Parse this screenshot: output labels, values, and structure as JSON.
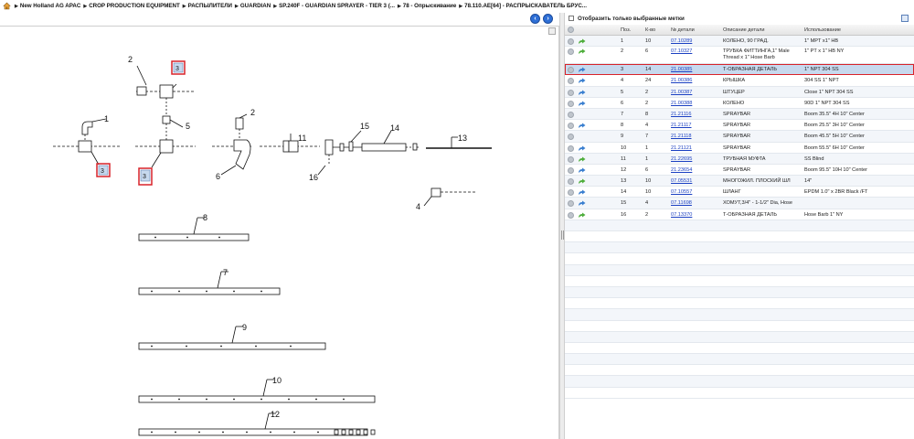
{
  "breadcrumb": [
    "New Holland AG APAC",
    "CROP PRODUCTION EQUIPMENT",
    "РАСПЫЛИТЕЛИ",
    "GUARDIAN",
    "SP.240F - GUARDIAN SPRAYER - TIER 3 (...",
    "78 - Опрыскивание",
    "78.110.AE[64] - РАСПРЫСКАВАТЕЛЬ БРУС..."
  ],
  "nav": {
    "back": "‹",
    "forward": "›"
  },
  "filter": {
    "label": "Отобразить только выбранные метки"
  },
  "table": {
    "headers": {
      "pos": "Поз.",
      "qty": "К-во",
      "num": "№ детали",
      "desc": "Описание детали",
      "use": "Использование"
    },
    "rows": [
      {
        "pos": "1",
        "qty": "10",
        "num": "07.10289",
        "desc": "КОЛЕНО, 90 ГРАД.",
        "use": "1\" MPT x1\" HB",
        "arrow": "green"
      },
      {
        "pos": "2",
        "qty": "6",
        "num": "07.10327",
        "desc": "ТРУБКА ФИТТИНГА,1\" Male Thread x 1\" Hose Barb",
        "use": "1\" PT x 1\" HB NY",
        "arrow": "green"
      },
      {
        "pos": "3",
        "qty": "14",
        "num": "21.00385",
        "desc": "Т-ОБРАЗНАЯ ДЕТАЛЬ",
        "use": "1\" NPT 304 SS",
        "arrow": "blue",
        "selected": true
      },
      {
        "pos": "4",
        "qty": "24",
        "num": "21.00386",
        "desc": "КРЫШКА",
        "use": "304 SS 1\" NPT",
        "arrow": "blue"
      },
      {
        "pos": "5",
        "qty": "2",
        "num": "21.00387",
        "desc": "ШТУЦЕР",
        "use": "Close 1\" NPT 304 SS",
        "arrow": "blue"
      },
      {
        "pos": "6",
        "qty": "2",
        "num": "21.00388",
        "desc": "КОЛЕНО",
        "use": "90D 1\" NPT 304 SS",
        "arrow": "blue"
      },
      {
        "pos": "7",
        "qty": "8",
        "num": "21.21116",
        "desc": "SPRAYBAR",
        "use": "Boom 35.5\" 4H 10\" Center",
        "arrow": "none"
      },
      {
        "pos": "8",
        "qty": "4",
        "num": "21.21117",
        "desc": "SPRAYBAR",
        "use": "Boom 25.5\" 3H 10\" Center",
        "arrow": "blue"
      },
      {
        "pos": "9",
        "qty": "7",
        "num": "21.21118",
        "desc": "SPRAYBAR",
        "use": "Boom 45.5\" 5H 10\" Center",
        "arrow": "none"
      },
      {
        "pos": "10",
        "qty": "1",
        "num": "21.21121",
        "desc": "SPRAYBAR",
        "use": "Boom 55.5\" 6H 10\" Center",
        "arrow": "blue"
      },
      {
        "pos": "11",
        "qty": "1",
        "num": "21.22695",
        "desc": "ТРУБНАЯ МУФТА",
        "use": "SS Blind",
        "arrow": "green"
      },
      {
        "pos": "12",
        "qty": "6",
        "num": "21.23654",
        "desc": "SPRAYBAR",
        "use": "Boom 95.5\" 10H 10\" Center",
        "arrow": "blue"
      },
      {
        "pos": "13",
        "qty": "10",
        "num": "07.05531",
        "desc": "МНОГОЖИЛ. ПЛОСКИЙ ШЛ",
        "use": "14\"",
        "arrow": "green"
      },
      {
        "pos": "14",
        "qty": "10",
        "num": "07.10557",
        "desc": "ШЛАНГ",
        "use": "EPDM 1.0\" x 2BR Black /FT",
        "arrow": "blue"
      },
      {
        "pos": "15",
        "qty": "4",
        "num": "07.11698",
        "desc": "ХОМУТ,3/4\" - 1-1/2\" Dia, Hose",
        "use": "",
        "arrow": "blue"
      },
      {
        "pos": "16",
        "qty": "2",
        "num": "07.13370",
        "desc": "Т-ОБРАЗНАЯ ДЕТАЛЬ",
        "use": "Hose Barb 1\" NY",
        "arrow": "green"
      }
    ],
    "empty_rows": 16
  },
  "callouts": {
    "c1": "1",
    "c2a": "2",
    "c2b": "2",
    "c3a": "3",
    "c3b": "3",
    "c3c": "3",
    "c4": "4",
    "c5": "5",
    "c6": "6",
    "c7": "7",
    "c8": "8",
    "c9": "9",
    "c10": "10",
    "c11": "11",
    "c12": "12",
    "c13": "13",
    "c14": "14",
    "c15": "15",
    "c16": "16"
  },
  "colors": {
    "highlight": "#d8232a",
    "link": "#1a3fc2",
    "selected_row": "#c7d9ee",
    "nav_button": "#2e6fd6"
  }
}
